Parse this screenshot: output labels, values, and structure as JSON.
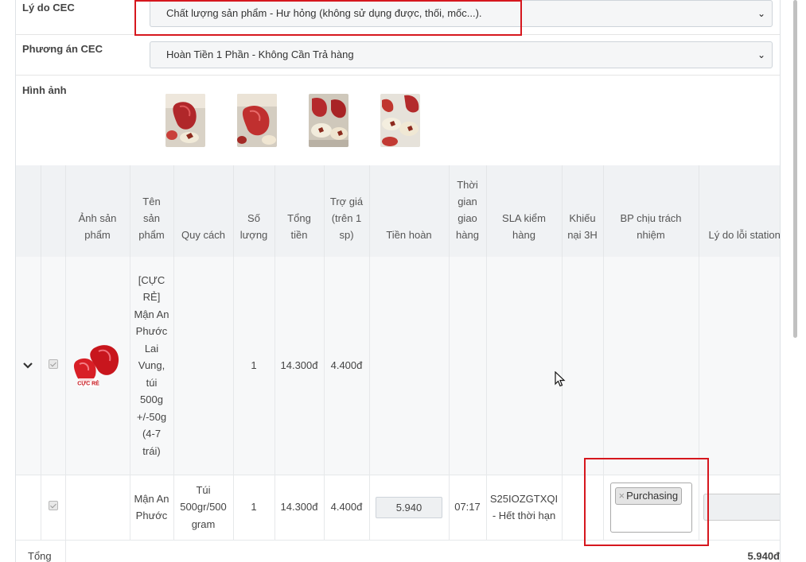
{
  "form": {
    "reason": {
      "label": "Lý do CEC",
      "value": "Chất lượng sản phẩm - Hư hỏng (không sử dụng được, thối, mốc...)."
    },
    "plan": {
      "label": "Phương án CEC",
      "value": "Hoàn Tiền 1 Phần - Không Cần Trả hàng"
    },
    "images": {
      "label": "Hình ảnh"
    }
  },
  "table": {
    "headers": {
      "image": "Ảnh sản phẩm",
      "name": "Tên sản phẩm",
      "spec": "Quy cách",
      "qty": "Số lượng",
      "total": "Tổng tiền",
      "subsidy": "Trợ giá (trên 1 sp)",
      "refund": "Tiền hoàn",
      "delivery_time": "Thời gian giao hàng",
      "sla": "SLA kiểm hàng",
      "complaint": "Khiếu nại 3H",
      "department": "BP chịu trách nhiệm",
      "station_reason": "Lý do lỗi station"
    },
    "product": {
      "name": "[CỰC RẺ] Mận An Phước Lai Vung, túi 500g +/-50g (4-7 trái)",
      "qty": "1",
      "total": "14.300đ",
      "subsidy": "4.400đ",
      "image_badge": "CỰC RẺ"
    },
    "item": {
      "name": "Mận An Phước",
      "spec": "Túi 500gr/500 gram",
      "qty": "1",
      "total": "14.300đ",
      "subsidy": "4.400đ",
      "refund": "5.940",
      "delivery_time": "07:17",
      "sla": "S25IOZGTXQI - Hết thời hạn",
      "department_tag": "Purchasing",
      "tag_remove": "×"
    },
    "footer": {
      "label": "Tổng",
      "value": "5.940đ"
    }
  },
  "icons": {
    "expand": "chevron-down-icon",
    "select": "chevron-down-icon",
    "cursor": "mouse-cursor-icon"
  },
  "colors": {
    "highlight": "#d6171e",
    "header_bg": "#f0f2f4",
    "row_bg": "#f7f8f9"
  }
}
